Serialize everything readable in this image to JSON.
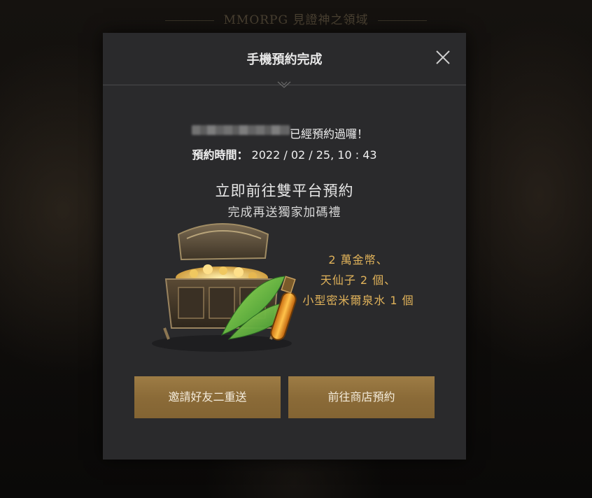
{
  "background": {
    "title": "MMORPG 見證神之領域"
  },
  "modal": {
    "title": "手機預約完成",
    "reserved_suffix": "已經預約過囉！",
    "time_label": "預約時間：",
    "time_value": "2022 / 02 / 25, 10 : 43",
    "headline": "立即前往雙平台預約",
    "subhead": "完成再送獨家加碼禮",
    "rewards": [
      "2 萬金幣、",
      "天仙子 2 個、",
      "小型密米爾泉水 1 個"
    ],
    "buttons": {
      "invite": "邀請好友二重送",
      "store": "前往商店預約"
    }
  },
  "colors": {
    "modal_bg": "#2a2a2c",
    "accent_gold": "#e0b25a",
    "button_gold": "#8b6b38",
    "text": "#f0f0f0"
  },
  "icons": {
    "close": "close-icon",
    "chest": "treasure-chest-illustration"
  }
}
